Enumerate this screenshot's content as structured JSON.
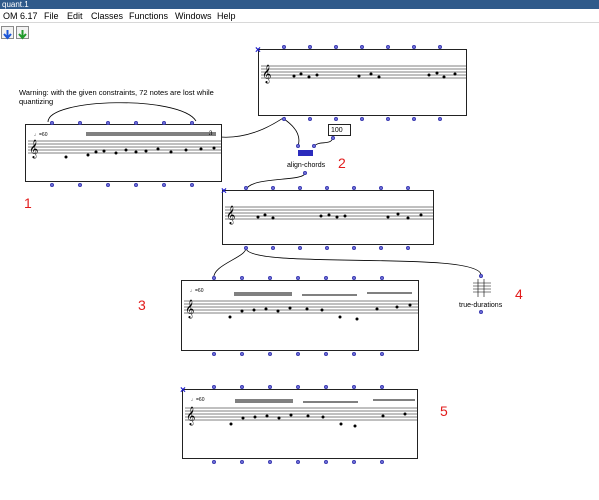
{
  "window": {
    "title": "quant.1"
  },
  "menu": {
    "items": [
      "OM 6.17",
      "File",
      "Edit",
      "Classes",
      "Functions",
      "Windows",
      "Help"
    ]
  },
  "toolbar": {
    "buttons": [
      "arrow-down-icon",
      "arrow-down-green-icon"
    ]
  },
  "warning_text": "Warning: with the given constraints, 72 notes are lost while quantizing",
  "boxes": {
    "input_voice": {
      "label": "1",
      "tempo": "♩=60"
    },
    "align": {
      "name": "align-chords",
      "label": "2",
      "value": "100"
    },
    "aligned_voice": {
      "label": ""
    },
    "quant_voice": {
      "label": "3",
      "tempo": "♩=60"
    },
    "true_durations": {
      "name": "true-durations",
      "label": "4"
    },
    "result_voice": {
      "label": "5",
      "tempo": "♩=60"
    }
  },
  "colors": {
    "title_bar": "#2f5a8a",
    "red_labels": "#e21b1b",
    "ports": "#7a7ae0",
    "lock": "#1818c8"
  }
}
